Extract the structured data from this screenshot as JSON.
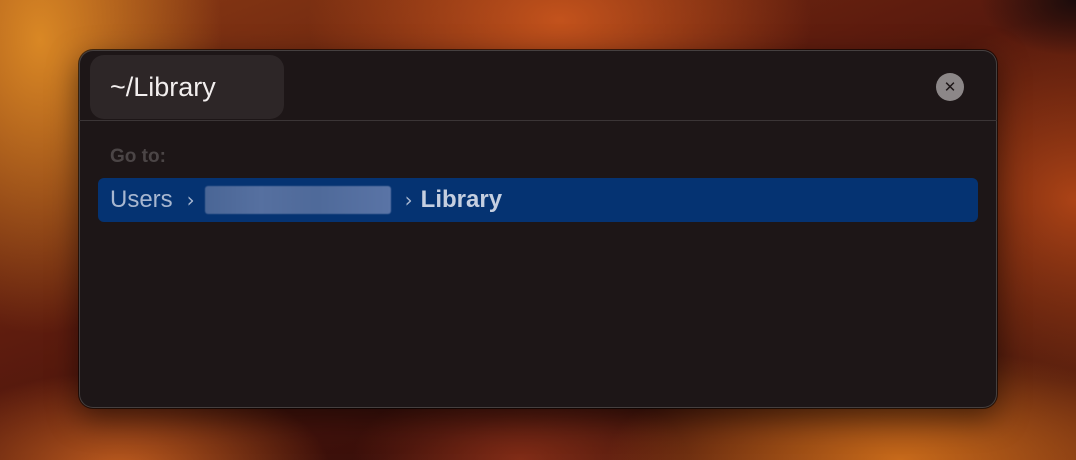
{
  "search": {
    "value": "~/Library",
    "clear_icon": "x-circle-icon",
    "clear_glyph": "✕"
  },
  "goto_label": "Go to:",
  "result": {
    "crumbs": [
      "Users",
      "Library"
    ],
    "separator": "›",
    "redacted_segment": true
  },
  "colors": {
    "dialog_bg": "#1d1617",
    "selection": "#053372",
    "input_bg": "#2d2627"
  }
}
